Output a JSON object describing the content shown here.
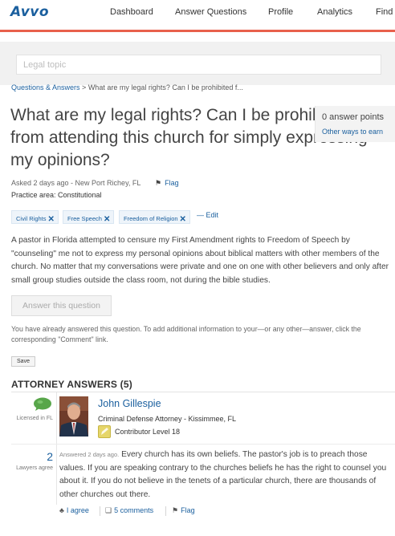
{
  "nav": {
    "logo": "Avvo",
    "items": [
      "Dashboard",
      "Answer Questions",
      "Profile",
      "Analytics",
      "Find"
    ]
  },
  "search": {
    "placeholder": "Legal topic",
    "value": ""
  },
  "breadcrumb": {
    "root": "Questions & Answers",
    "separator": " > ",
    "current": "What are my legal rights? Can I be prohibited f..."
  },
  "question": {
    "title": "What are my legal rights? Can I be prohibited from attending this church for simply expressing my opinions?",
    "meta": "Asked 2 days ago - New Port Richey, FL",
    "flag": "Flag",
    "practice_area": "Practice area: Constitutional",
    "tags": [
      "Civil Rights",
      "Free Speech",
      "Freedom of Religion"
    ],
    "edit": "Edit",
    "body": "A pastor in Florida attempted to censure my First Amendment rights to Freedom of Speech by \"counseling\" me not to express my personal opinions about biblical matters with other members of the church. No matter that my conversations were private and one on one with other believers and only after small group studies outside the class room, not during the bible studies."
  },
  "points": {
    "label": "0 answer points",
    "link": "Other ways to earn"
  },
  "actions": {
    "answer_button": "Answer this question",
    "already_note": "You have already answered this question. To add additional information to your—or any other—answer, click the corresponding \"Comment\" link.",
    "save_button": "Save"
  },
  "answers": {
    "heading": "ATTORNEY ANSWERS (5)",
    "items": [
      {
        "licensed_label": "Licensed in FL",
        "name": "John Gillespie",
        "title": "Criminal Defense Attorney - Kissimmee, FL",
        "level": "Contributor Level 18",
        "agree_count": "2",
        "agree_label": "Lawyers agree",
        "answered": "Answered 2 days ago.",
        "text": "Every church has its own beliefs. The pastor's job is to preach those values. If you are speaking contrary to the churches beliefs he has the right to counsel you about it. If you do not believe in the tenets of a particular church, there are thousands of other churches out there.",
        "agree_action": "I agree",
        "comments": "5 comments",
        "flag": "Flag"
      }
    ]
  },
  "colors": {
    "brand_blue": "#1a5f9e",
    "accent_red": "#e8604c",
    "licensed_green": "#58a64a",
    "level_gold": "#e6d66a"
  }
}
